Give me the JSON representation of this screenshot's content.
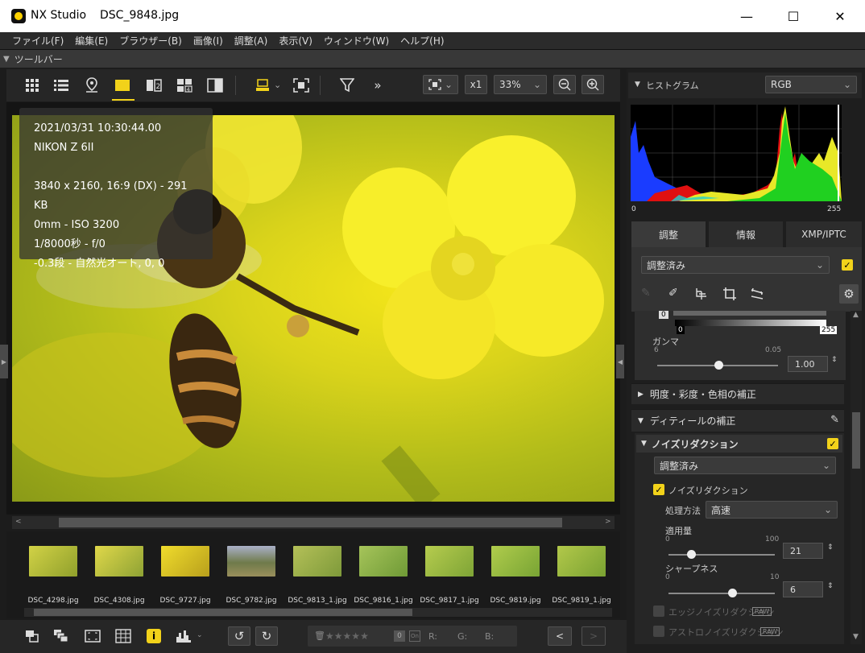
{
  "window": {
    "app_name": "NX Studio",
    "file_name": "DSC_9848.jpg",
    "minimize": "—",
    "maximize": "☐",
    "close": "✕"
  },
  "menu": [
    "ファイル(F)",
    "編集(E)",
    "ブラウザー(B)",
    "画像(I)",
    "調整(A)",
    "表示(V)",
    "ウィンドウ(W)",
    "ヘルプ(H)"
  ],
  "toolbar_label": "ツールバー",
  "viewer_toolbar": {
    "zoom_mode": "x1",
    "zoom_percent": "33%"
  },
  "photo_info": {
    "datetime": "2021/03/31 10:30:44.00",
    "camera": "NIKON Z 6II",
    "dimensions": "3840 x 2160, 16:9 (DX) - 291 KB",
    "focal_iso": "0mm - ISO 3200",
    "shutter_aperture": "1/8000秒 - f/0",
    "exposure_wb": "-0.3段 - 自然光オート, 0, 0"
  },
  "filmstrip": {
    "items": [
      {
        "label": "DSC_4298.jpg",
        "color": "#b9c236"
      },
      {
        "label": "DSC_4308.jpg",
        "color": "#c9c43c"
      },
      {
        "label": "DSC_9727.jpg",
        "color": "#d8c52a"
      },
      {
        "label": "DSC_9782.jpg",
        "color": "#8a9470"
      },
      {
        "label": "DSC_9813_1.jpg",
        "color": "#9fae4a"
      },
      {
        "label": "DSC_9816_1.jpg",
        "color": "#8fb04c"
      },
      {
        "label": "DSC_9817_1.jpg",
        "color": "#a1b840"
      },
      {
        "label": "DSC_9819.jpg",
        "color": "#9cba3e"
      },
      {
        "label": "DSC_9819_1.jpg",
        "color": "#9db63c"
      }
    ]
  },
  "statusbar": {
    "rating_value": "0",
    "r_label": "R:",
    "g_label": "G:",
    "b_label": "B:"
  },
  "histogram": {
    "title": "ヒストグラム",
    "channel": "RGB",
    "min_label": "0",
    "max_label": "255"
  },
  "tabs": [
    "調整",
    "情報",
    "XMP/IPTC"
  ],
  "adjust": {
    "preset": "調整済み",
    "levels_low": "0",
    "levels_out_low": "0",
    "levels_out_high": "255",
    "gamma_label": "ガンマ",
    "gamma_min": "6",
    "gamma_max": "0.05",
    "gamma_value": "1.00",
    "section_brightness": "明度・彩度・色相の補正",
    "section_detail": "ディティールの補正",
    "noise_reduction": {
      "title": "ノイズリダクション",
      "preset": "調整済み",
      "enable_label": "ノイズリダクション",
      "method_label": "処理方法",
      "method_value": "高速",
      "amount_label": "適用量",
      "amount_min": "0",
      "amount_max": "100",
      "amount_value": "21",
      "amount_level": 0.21,
      "sharpness_label": "シャープネス",
      "sharpness_min": "0",
      "sharpness_max": "10",
      "sharpness_value": "6",
      "sharpness_level": 0.6,
      "edge_label": "エッジノイズリダクション",
      "astro_label": "アストロノイズリダクション",
      "raw_tag": "RAW"
    }
  },
  "colors": {
    "accent_yellow": "#f2d21a",
    "background": "#1c1c1c"
  }
}
